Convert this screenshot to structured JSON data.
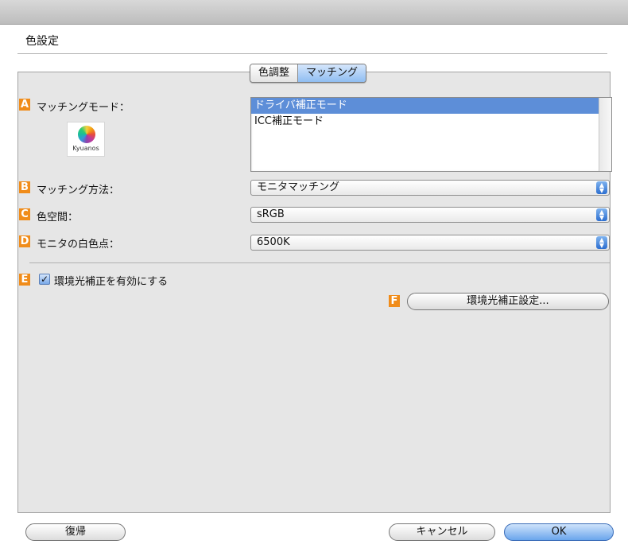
{
  "window": {
    "title": "色設定"
  },
  "tabs": [
    {
      "label": "色調整",
      "active": false
    },
    {
      "label": "マッチング",
      "active": true
    }
  ],
  "badges": {
    "a": "A",
    "b": "B",
    "c": "C",
    "d": "D",
    "e": "E",
    "f": "F"
  },
  "matching_mode": {
    "label": "マッチングモード：",
    "options": [
      "ドライバ補正モード",
      "ICC補正モード"
    ],
    "selected": "ドライバ補正モード"
  },
  "logo": {
    "text": "Kyuanos"
  },
  "matching_method": {
    "label": "マッチング方法：",
    "value": "モニタマッチング"
  },
  "color_space": {
    "label": "色空間：",
    "value": "sRGB"
  },
  "white_point": {
    "label": "モニタの白色点：",
    "value": "6500K"
  },
  "ambient_light": {
    "label": "環境光補正を有効にする",
    "checked": true
  },
  "ambient_settings_button": "環境光補正設定...",
  "footer": {
    "restore_button": "復帰",
    "cancel_button": "キャンセル",
    "ok_button": "OK"
  },
  "colors": {
    "badge": "#f08c1a",
    "selection": "#5d8ed8",
    "accent": "#6aa5ec"
  }
}
